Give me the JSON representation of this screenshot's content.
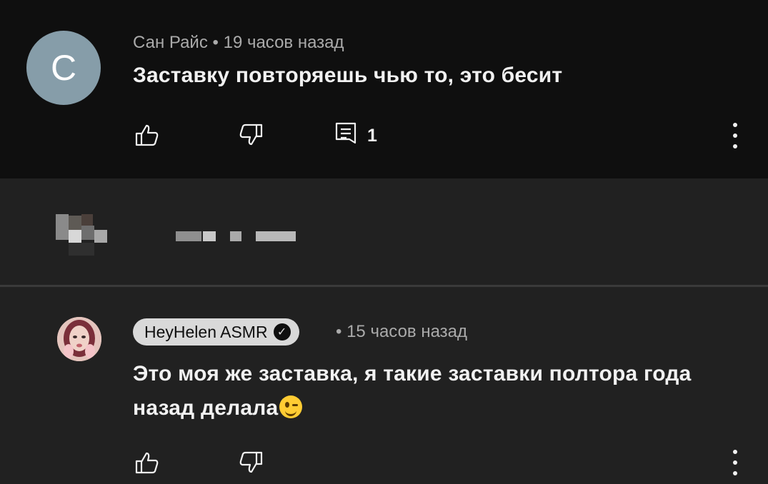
{
  "comment": {
    "avatar_letter": "С",
    "author": "Сан Райс",
    "separator": "•",
    "time": "19 часов назад",
    "text": "Заставку повторяешь чью то, это бесит",
    "reply_count": "1",
    "icons": [
      "like-icon",
      "dislike-icon",
      "reply-icon",
      "more-vert-icon"
    ]
  },
  "reply": {
    "channel": "HeyHelen ASMR",
    "verified_icon": "check-icon",
    "separator": "•",
    "time": "15 часов назад",
    "text": "Это моя же заставка, я такие заставки полтора года назад делала",
    "emoji": "winking-face-emoji",
    "icons": [
      "like-icon",
      "dislike-icon",
      "more-vert-icon"
    ]
  },
  "colors": {
    "top_bg": "#0f0f0f",
    "body_bg": "#212121",
    "meta_text": "#aaaaaa",
    "chip_bg": "#d9d9d9",
    "avatar_bg": "#869da9"
  }
}
